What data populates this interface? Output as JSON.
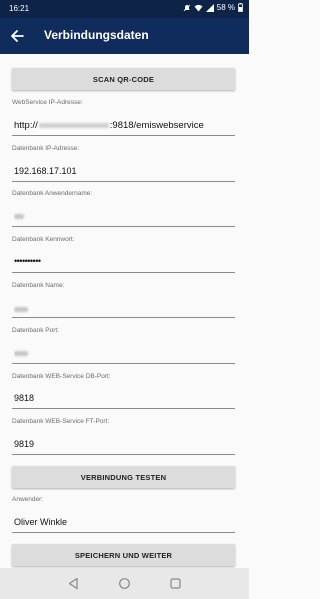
{
  "status_bar": {
    "time": "16:21",
    "battery": "58 %"
  },
  "app_bar": {
    "title": "Verbindungsdaten",
    "back_icon": "arrow-left-icon"
  },
  "buttons": {
    "scan_qr": "SCAN QR-CODE",
    "test_connection": "VERBINDUNG TESTEN",
    "save_continue": "SPEICHERN UND WEITER"
  },
  "fields": {
    "webservice_ip": {
      "label": "WebService IP-Adresse:",
      "value_prefix": "http://",
      "value_suffix": ":9818/emiswebservice"
    },
    "db_ip": {
      "label": "Datenbank IP-Adresse:",
      "value": "192.168.17.101"
    },
    "db_user": {
      "label": "Datenbank Anwendername:"
    },
    "db_password": {
      "label": "Datenbank Kennwort:",
      "value": "••••••••••"
    },
    "db_name": {
      "label": "Datenbank Name:"
    },
    "db_port": {
      "label": "Datenbank Port:"
    },
    "ws_db_port": {
      "label": "Datenbank WEB-Service DB-Port:",
      "value": "9818"
    },
    "ws_ft_port": {
      "label": "Datenbank WEB-Service FT-Port:",
      "value": "9819"
    },
    "user": {
      "label": "Anwender:",
      "value": "Oliver Winkle"
    }
  },
  "nav_bar": {
    "back": "triangle-back-icon",
    "home": "circle-home-icon",
    "recents": "square-recents-icon"
  }
}
